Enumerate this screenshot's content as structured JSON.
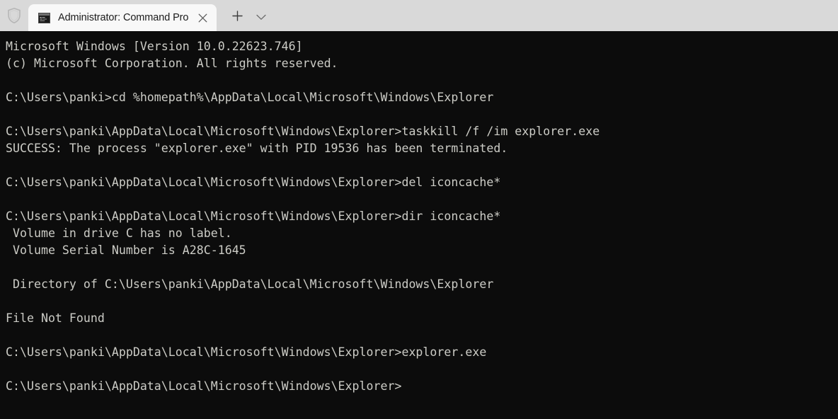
{
  "window": {
    "shield_icon": "shield-icon",
    "tabs": [
      {
        "title": "Administrator: Command Pro",
        "icon": "console-window-icon",
        "close_icon": "close-icon",
        "active": true
      }
    ],
    "new_tab_icon": "plus-icon",
    "dropdown_icon": "chevron-down-icon",
    "titlebar_bg": "#d9d9d9",
    "active_tab_bg": "#f8f8f8"
  },
  "terminal": {
    "background": "#0c0c0c",
    "foreground": "#ccccc6",
    "prompt_user_path": "C:\\Users\\panki",
    "working_directory": "C:\\Users\\panki\\AppData\\Local\\Microsoft\\Windows\\Explorer",
    "lines": [
      "Microsoft Windows [Version 10.0.22623.746]",
      "(c) Microsoft Corporation. All rights reserved.",
      "",
      "C:\\Users\\panki>cd %homepath%\\AppData\\Local\\Microsoft\\Windows\\Explorer",
      "",
      "C:\\Users\\panki\\AppData\\Local\\Microsoft\\Windows\\Explorer>taskkill /f /im explorer.exe",
      "SUCCESS: The process \"explorer.exe\" with PID 19536 has been terminated.",
      "",
      "C:\\Users\\panki\\AppData\\Local\\Microsoft\\Windows\\Explorer>del iconcache*",
      "",
      "C:\\Users\\panki\\AppData\\Local\\Microsoft\\Windows\\Explorer>dir iconcache*",
      " Volume in drive C has no label.",
      " Volume Serial Number is A28C-1645",
      "",
      " Directory of C:\\Users\\panki\\AppData\\Local\\Microsoft\\Windows\\Explorer",
      "",
      "File Not Found",
      "",
      "C:\\Users\\panki\\AppData\\Local\\Microsoft\\Windows\\Explorer>explorer.exe",
      "",
      "C:\\Users\\panki\\AppData\\Local\\Microsoft\\Windows\\Explorer>"
    ],
    "version_string": "10.0.22623.746",
    "copyright": "(c) Microsoft Corporation. All rights reserved.",
    "pid": "19536",
    "volume_serial": "A28C-1645",
    "volume_label_status": "no label",
    "drive": "C",
    "dir_result": "File Not Found",
    "commands": [
      "cd %homepath%\\AppData\\Local\\Microsoft\\Windows\\Explorer",
      "taskkill /f /im explorer.exe",
      "del iconcache*",
      "dir iconcache*",
      "explorer.exe"
    ]
  }
}
